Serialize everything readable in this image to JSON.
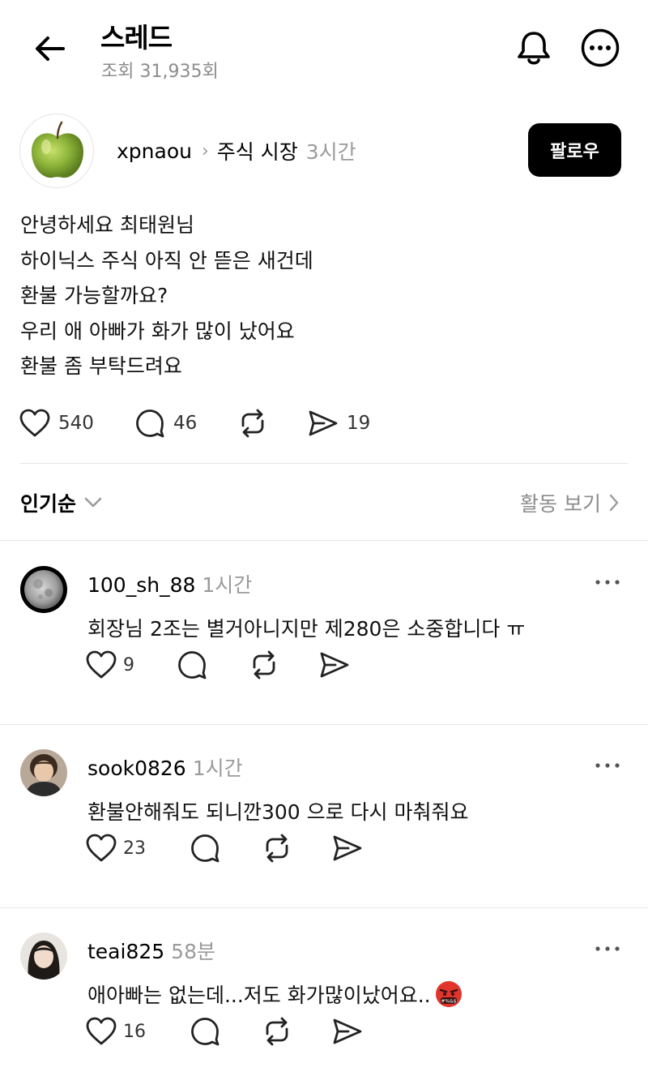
{
  "header": {
    "title": "스레드",
    "views": "조회 31,935회"
  },
  "post": {
    "author": "xpnaou",
    "separator": "›",
    "topic": "주식 시장",
    "time": "3시간",
    "follow_label": "팔로우",
    "lines": [
      "안녕하세요 최태원님",
      "하이닉스 주식 아직 안 뜯은 새건데",
      "환불 가능할까요?",
      "우리 애 아빠가 화가 많이 났어요",
      "환불 좀 부탁드려요"
    ],
    "likes": "540",
    "replies": "46",
    "shares": "19"
  },
  "sort": {
    "label": "인기순",
    "activity": "활동 보기"
  },
  "comments": [
    {
      "user": "100_sh_88",
      "time": "1시간",
      "text": "회장님 2조는 별거아니지만 제280은 소중합니다 ㅠ",
      "likes": "9",
      "emoji": ""
    },
    {
      "user": "sook0826",
      "time": "1시간",
      "text": "환불안해줘도 되니깐300 으로 다시 마춰줘요",
      "likes": "23",
      "emoji": ""
    },
    {
      "user": "teai825",
      "time": "58분",
      "text": "애아빠는 없는데...저도 화가많이났어요..",
      "likes": "16",
      "emoji": "face-with-symbols-on-mouth"
    }
  ],
  "colors": {
    "accent": "#000000",
    "muted": "#9a9a9a",
    "divider": "#e6e6e6"
  }
}
